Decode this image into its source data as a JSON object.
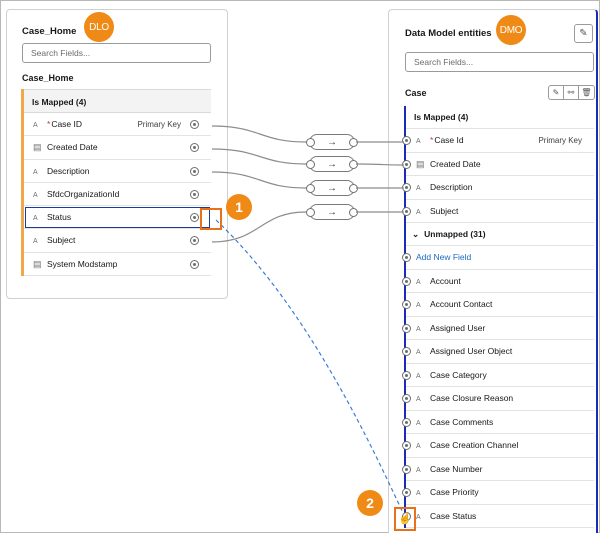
{
  "left": {
    "title": "Case_Home",
    "badge": "DLO",
    "search_placeholder": "Search Fields...",
    "object_label": "Case_Home",
    "group_header": "Is Mapped (4)",
    "rows": [
      {
        "icon": "text-field-icon",
        "glyph": "A",
        "name": "Case ID",
        "required": true,
        "key": "Primary Key"
      },
      {
        "icon": "date-field-icon",
        "glyph": "▤",
        "name": "Created Date",
        "required": false,
        "key": ""
      },
      {
        "icon": "text-field-icon",
        "glyph": "A",
        "name": "Description",
        "required": false,
        "key": ""
      },
      {
        "icon": "text-field-icon",
        "glyph": "A",
        "name": "SfdcOrganizationId",
        "required": false,
        "key": ""
      },
      {
        "icon": "text-field-icon",
        "glyph": "A",
        "name": "Status",
        "required": false,
        "key": ""
      },
      {
        "icon": "text-field-icon",
        "glyph": "A",
        "name": "Subject",
        "required": false,
        "key": ""
      },
      {
        "icon": "date-field-icon",
        "glyph": "▤",
        "name": "System Modstamp",
        "required": false,
        "key": ""
      }
    ]
  },
  "right": {
    "title": "Data Model entities",
    "badge": "DMO",
    "search_placeholder": "Search Fields...",
    "object_label": "Case",
    "mapped_header": "Is Mapped (4)",
    "mapped_rows": [
      {
        "glyph": "A",
        "name": "Case Id",
        "required": true,
        "key": "Primary Key"
      },
      {
        "glyph": "▤",
        "name": "Created Date",
        "required": false,
        "key": ""
      },
      {
        "glyph": "A",
        "name": "Description",
        "required": false,
        "key": ""
      },
      {
        "glyph": "A",
        "name": "Subject",
        "required": false,
        "key": ""
      }
    ],
    "unmapped_header": "Unmapped (31)",
    "add_new_field": "Add New Field",
    "unmapped_rows": [
      "Account",
      "Account Contact",
      "Assigned User",
      "Assigned User Object",
      "Case Category",
      "Case Closure Reason",
      "Case Comments",
      "Case Creation Channel",
      "Case Number",
      "Case Priority",
      "Case Status"
    ]
  },
  "transforms": [
    "→",
    "→",
    "→",
    "→"
  ],
  "callouts": [
    "1",
    "2"
  ],
  "colors": {
    "badge": "#f08a16",
    "mapped_accent": "#f0a94a",
    "selected_border": "#1b3c98",
    "drag_line": "#3b7dd8",
    "link": "#1b6ac0"
  }
}
